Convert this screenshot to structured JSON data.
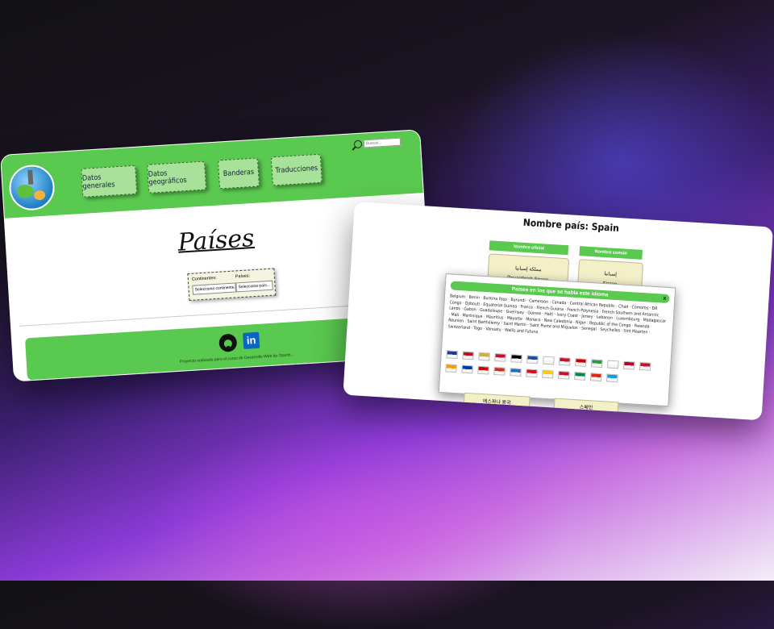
{
  "left_page": {
    "nav": [
      "Datos generales",
      "Datos geográficos",
      "Banderas",
      "Traducciones"
    ],
    "search_placeholder": "Buscar...",
    "title": "Países",
    "filters": {
      "continent_label": "Continentes:",
      "continent_value": "Selecciona continente...",
      "country_label": "Países:",
      "country_value": "Selecciona país..."
    },
    "footer_text": "Proyecto realizado para el curso de Desarrollo Web de Openb..."
  },
  "right_page": {
    "title": "Nombre país: Spain",
    "official_header": "Nombre oficial",
    "common_header": "Nombre común",
    "official_native": "مملكة إسبانيا",
    "official_value": "Reuantloiah Spagn",
    "common_native": "إسبانيا",
    "common_value": "Spagn",
    "modal_title": "Países en los que se habla este idioma",
    "modal_close": "x",
    "countries_text": "Belgium · Benin · Burkina Faso · Burundi · Cameroon · Canada · Central African Republic · Chad · Comoros · DR Congo · Djibouti · Equatorial Guinea · France · French Guiana · French Polynesia · French Southern and Antarctic Lands · Gabon · Guadeloupe · Guernsey · Guinea · Haiti · Ivory Coast · Jersey · Lebanon · Luxembourg · Madagascar · Mali · Martinique · Mauritius · Mayotte · Monaco · New Caledonia · Niger · Republic of the Congo · Rwanda · Réunion · Saint Barthélemy · Saint Martin · Saint Pierre and Miquelon · Senegal · Seychelles · Sint Maarten · Switzerland · Togo · Vanuatu · Wallis and Futuna",
    "translation_left": "에스파냐 왕국",
    "translation_right": "스페인",
    "flag_colors": [
      "#1f3b8c",
      "#c60b1e",
      "#d4af37",
      "#c8102e",
      "#000000",
      "#1f4fa0",
      "#ffffff",
      "#c8102e",
      "#cc0000",
      "#2a9d3a",
      "#ffffff",
      "#bc002d",
      "#c8102e",
      "#ff9900",
      "#003da5",
      "#cc0000",
      "#d52b1e",
      "#2b6cb0",
      "#e30a17",
      "#ffcd00",
      "#c8102e",
      "#008751",
      "#de2910",
      "#00a3dd"
    ]
  }
}
